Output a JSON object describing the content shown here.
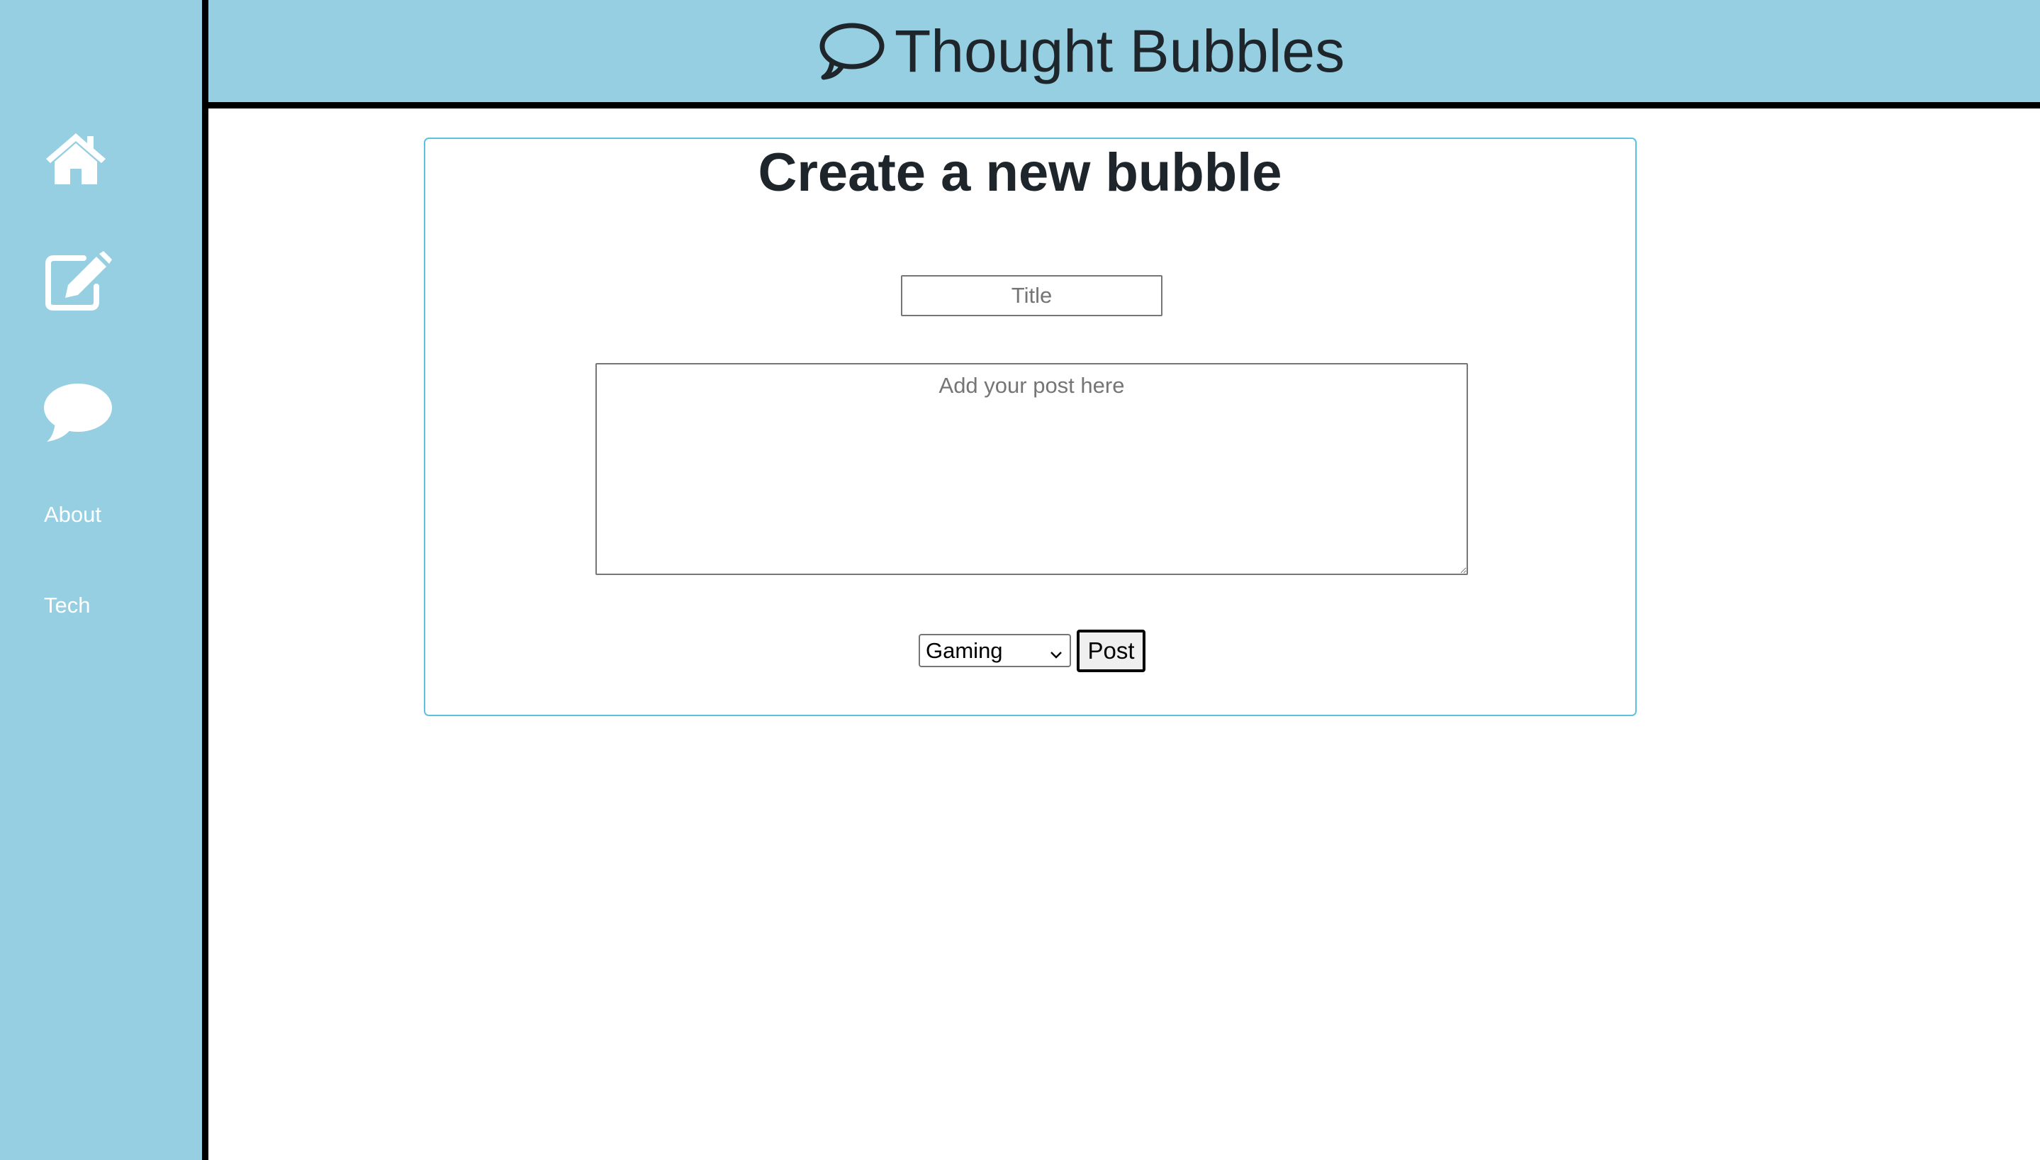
{
  "header": {
    "title": "Thought Bubbles",
    "icon": "speech-bubble-icon"
  },
  "sidebar": {
    "items": [
      {
        "icon": "home-icon"
      },
      {
        "icon": "edit-icon"
      },
      {
        "icon": "chat-bubble-icon"
      },
      {
        "label": "About"
      },
      {
        "label": "Tech"
      }
    ]
  },
  "form": {
    "heading": "Create a new bubble",
    "title_placeholder": "Title",
    "title_value": "",
    "post_placeholder": "Add your post here",
    "post_value": "",
    "category_selected": "Gaming",
    "post_button_label": "Post"
  },
  "colors": {
    "sidebar_bg": "#96cfe1",
    "header_bg": "#96cfe1",
    "card_border": "#5cc2df",
    "text_dark": "#1e252b"
  }
}
